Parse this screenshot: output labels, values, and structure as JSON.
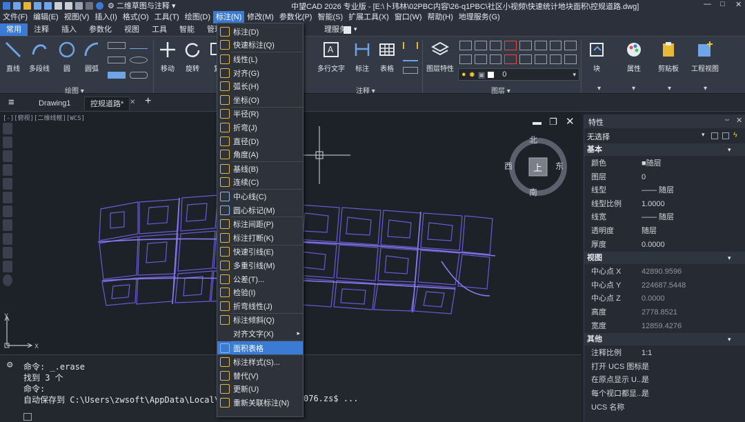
{
  "titlebar": {
    "workspace": "二维草图与注释",
    "title": "中望CAD 2026 专业版 - [E:\\卜玮林\\02PBC内容\\26-q1PBC\\社区小视频\\快速统计地块面积\\控规道路.dwg]"
  },
  "menubar": [
    "文件(F)",
    "编辑(E)",
    "视图(V)",
    "插入(I)",
    "格式(O)",
    "工具(T)",
    "绘图(D)",
    "标注(N)",
    "修改(M)",
    "参数化(P)",
    "智能(S)",
    "扩展工具(X)",
    "窗口(W)",
    "帮助(H)",
    "地理服务(G)"
  ],
  "ribbon_tabs": [
    "常用",
    "注释",
    "插入",
    "参数化",
    "视图",
    "工具",
    "智能",
    "管理",
    "理服务"
  ],
  "ribbon": {
    "draw": {
      "items": [
        "直线",
        "多段线",
        "圆",
        "圆弧"
      ],
      "group": "绘图"
    },
    "modify": {
      "items": [
        "移动",
        "旋转",
        "复"
      ]
    },
    "annotation": {
      "items": [
        "多行文字",
        "标注",
        "表格"
      ],
      "group": "注释"
    },
    "layers": {
      "items": [
        "图层特性"
      ],
      "group": "图层",
      "layer_value": "0"
    },
    "right": [
      "块",
      "属性",
      "剪贴板",
      "工程视图"
    ]
  },
  "doc_tabs": [
    "Drawing1",
    "控规道路*"
  ],
  "viewport_label": "[-][俯视][二维线框][WCS]",
  "compass": {
    "n": "北",
    "s": "南",
    "w": "西",
    "e": "东",
    "center": "上"
  },
  "ucs": {
    "x": "X",
    "y": "Y"
  },
  "command_lines": [
    "命令: _.erase",
    "找到 3 个",
    "命令:",
    "自动保存到 C:\\Users\\zwsoft\\AppData\\Local\\T",
    "076.zs$ ..."
  ],
  "dropdown": [
    {
      "label": "标注(D)",
      "color": "#e7b934"
    },
    {
      "label": "快速标注(Q)",
      "color": "#e7b934"
    },
    {
      "sep": true
    },
    {
      "label": "线性(L)",
      "color": "#e7b934"
    },
    {
      "label": "对齐(G)",
      "color": "#e7b934"
    },
    {
      "label": "弧长(H)",
      "color": "#e7b934"
    },
    {
      "label": "坐标(O)",
      "color": "#e7b934"
    },
    {
      "sep": true
    },
    {
      "label": "半径(R)",
      "color": "#e7b934"
    },
    {
      "label": "折弯(J)",
      "color": "#e7b934"
    },
    {
      "label": "直径(D)",
      "color": "#e7b934"
    },
    {
      "label": "角度(A)",
      "color": "#e7b934"
    },
    {
      "sep": true
    },
    {
      "label": "基线(B)",
      "color": "#e7b934"
    },
    {
      "label": "连续(C)",
      "color": "#e7b934"
    },
    {
      "sep": true
    },
    {
      "label": "中心线(C)",
      "color": "#8fb7e8"
    },
    {
      "label": "圆心标记(M)",
      "color": "#8fb7e8"
    },
    {
      "sep": true
    },
    {
      "label": "标注间距(P)",
      "color": "#e7b934"
    },
    {
      "label": "标注打断(K)",
      "color": "#e7b934"
    },
    {
      "sep": true
    },
    {
      "label": "快速引线(E)",
      "color": "#e7b934"
    },
    {
      "label": "多重引线(M)",
      "color": "#e7b934"
    },
    {
      "label": "公差(T)...",
      "color": "#e7b934"
    },
    {
      "label": "检验(I)",
      "color": "#e7b934"
    },
    {
      "label": "折弯线性(J)",
      "color": "#e7b934"
    },
    {
      "sep": true
    },
    {
      "label": "标注倾斜(Q)",
      "color": "#e7b934"
    },
    {
      "label": "对齐文字(X)",
      "color": "",
      "submenu": true
    },
    {
      "sep": true
    },
    {
      "label": "面积表格",
      "color": "#8fb7e8",
      "highlight": true
    },
    {
      "sep": true
    },
    {
      "label": "标注样式(S)...",
      "color": "#e7b934"
    },
    {
      "label": "替代(V)",
      "color": "#e7b934"
    },
    {
      "label": "更新(U)",
      "color": "#e7b934"
    },
    {
      "label": "重新关联标注(N)",
      "color": "#e7b934"
    }
  ],
  "properties": {
    "title": "特性",
    "selection": "无选择",
    "sections": [
      {
        "name": "基本",
        "rows": [
          [
            "颜色",
            "■随层"
          ],
          [
            "图层",
            "0"
          ],
          [
            "线型",
            "—— 随层"
          ],
          [
            "线型比例",
            "1.0000"
          ],
          [
            "线宽",
            "—— 随层"
          ],
          [
            "透明度",
            "随层"
          ],
          [
            "厚度",
            "0.0000"
          ]
        ]
      },
      {
        "name": "视图",
        "rows": [
          [
            "中心点 X",
            "42890.9596"
          ],
          [
            "中心点 Y",
            "224687.5448"
          ],
          [
            "中心点 Z",
            "0.0000"
          ],
          [
            "高度",
            "2778.8521"
          ],
          [
            "宽度",
            "12859.4276"
          ]
        ]
      },
      {
        "name": "其他",
        "rows": [
          [
            "注释比例",
            "1:1"
          ],
          [
            "打开 UCS 图标",
            "是"
          ],
          [
            "在原点显示 U...",
            "是"
          ],
          [
            "每个视口都显...",
            "是"
          ],
          [
            "UCS 名称",
            ""
          ]
        ]
      }
    ]
  }
}
